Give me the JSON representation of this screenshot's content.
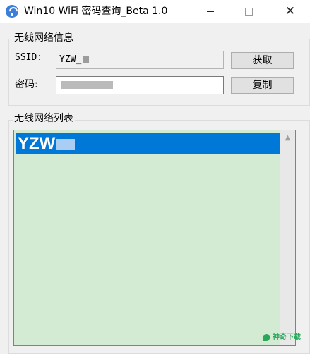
{
  "window": {
    "title": "Win10 WiFi 密码查询_Beta 1.0",
    "app_icon": "wifi-icon",
    "controls": [
      "minimize-icon",
      "maximize-icon",
      "close-icon"
    ],
    "close_glyph": "✕"
  },
  "info_group": {
    "legend": "无线网络信息",
    "ssid_label": "SSID:",
    "ssid_value": "YZW_",
    "password_label": "密码:",
    "get_button": "获取",
    "copy_button": "复制"
  },
  "list_group": {
    "legend": "无线网络列表",
    "items": [
      {
        "label": "YZW",
        "selected": true
      }
    ],
    "scroll_up_glyph": "▲"
  },
  "watermark": {
    "text": "神奇下载"
  },
  "colors": {
    "list_background": "#d2ebd2",
    "selection": "#0078d7",
    "watermark": "#2aa85a"
  }
}
